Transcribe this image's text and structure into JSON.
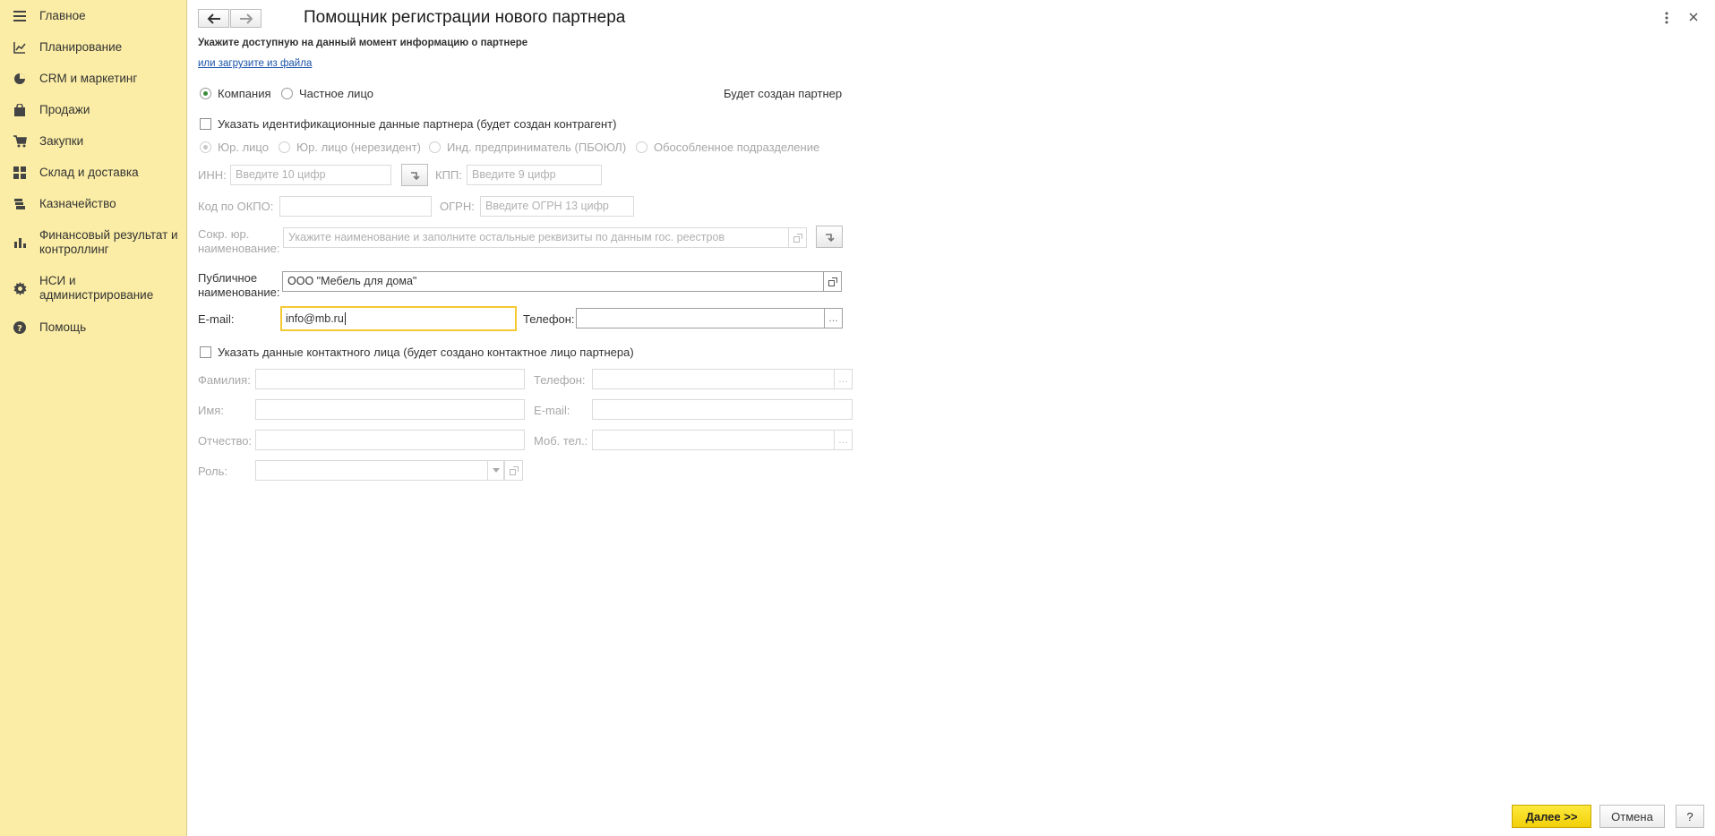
{
  "sidebar": {
    "items": [
      {
        "label": "Главное",
        "icon": "menu-icon"
      },
      {
        "label": "Планирование",
        "icon": "planning-chart-icon"
      },
      {
        "label": "CRM и маркетинг",
        "icon": "pie-chart-icon"
      },
      {
        "label": "Продажи",
        "icon": "shopping-bag-icon"
      },
      {
        "label": "Закупки",
        "icon": "cart-icon"
      },
      {
        "label": "Склад и доставка",
        "icon": "warehouse-grid-icon"
      },
      {
        "label": "Казначейство",
        "icon": "coins-icon"
      },
      {
        "label": "Финансовый результат и контроллинг",
        "icon": "bar-chart-icon"
      },
      {
        "label": "НСИ и администрирование",
        "icon": "gear-icon"
      },
      {
        "label": "Помощь",
        "icon": "help-icon"
      }
    ]
  },
  "header": {
    "title": "Помощник регистрации нового партнера",
    "subtitle": "Укажите доступную на данный момент информацию о партнере",
    "load_link": "или загрузите из файла"
  },
  "partner_type": {
    "options": [
      "Компания",
      "Частное лицо"
    ],
    "selected": "Компания",
    "result_text": "Будет создан партнер"
  },
  "identification": {
    "checkbox_label": "Указать идентификационные данные партнера (будет создан контрагент)",
    "legal_forms": [
      "Юр. лицо",
      "Юр. лицо (нерезидент)",
      "Инд. предприниматель (ПБОЮЛ)",
      "Обособленное подразделение"
    ],
    "inn_label": "ИНН:",
    "inn_placeholder": "Введите 10 цифр",
    "kpp_label": "КПП:",
    "kpp_placeholder": "Введите 9 цифр",
    "okpo_label": "Код по ОКПО:",
    "okpo_value": "",
    "ogrn_label": "ОГРН:",
    "ogrn_placeholder": "Введите ОГРН 13 цифр",
    "short_name_label": "Сокр. юр. наименование:",
    "short_name_placeholder": "Укажите наименование и заполните остальные реквизиты по данным гос. реестров"
  },
  "public": {
    "name_label": "Публичное наименование:",
    "name_value": "ООО \"Мебель для дома\"",
    "email_label": "E-mail:",
    "email_value": "info@mb.ru",
    "phone_label": "Телефон:",
    "phone_value": ""
  },
  "contact": {
    "checkbox_label": "Указать данные контактного лица (будет создано контактное лицо партнера)",
    "surname_label": "Фамилия:",
    "name_label": "Имя:",
    "patronymic_label": "Отчество:",
    "role_label": "Роль:",
    "phone_label": "Телефон:",
    "email_label": "E-mail:",
    "mobile_label": "Моб. тел.:"
  },
  "footer": {
    "next_label": "Далее >>",
    "cancel_label": "Отмена",
    "help_label": "?"
  },
  "colors": {
    "sidebar_bg": "#fbeda5",
    "primary_button": "#f5d50f",
    "active_field_border": "#f5c932",
    "radio_selected": "#3c8c3c",
    "link": "#1a53a8"
  }
}
